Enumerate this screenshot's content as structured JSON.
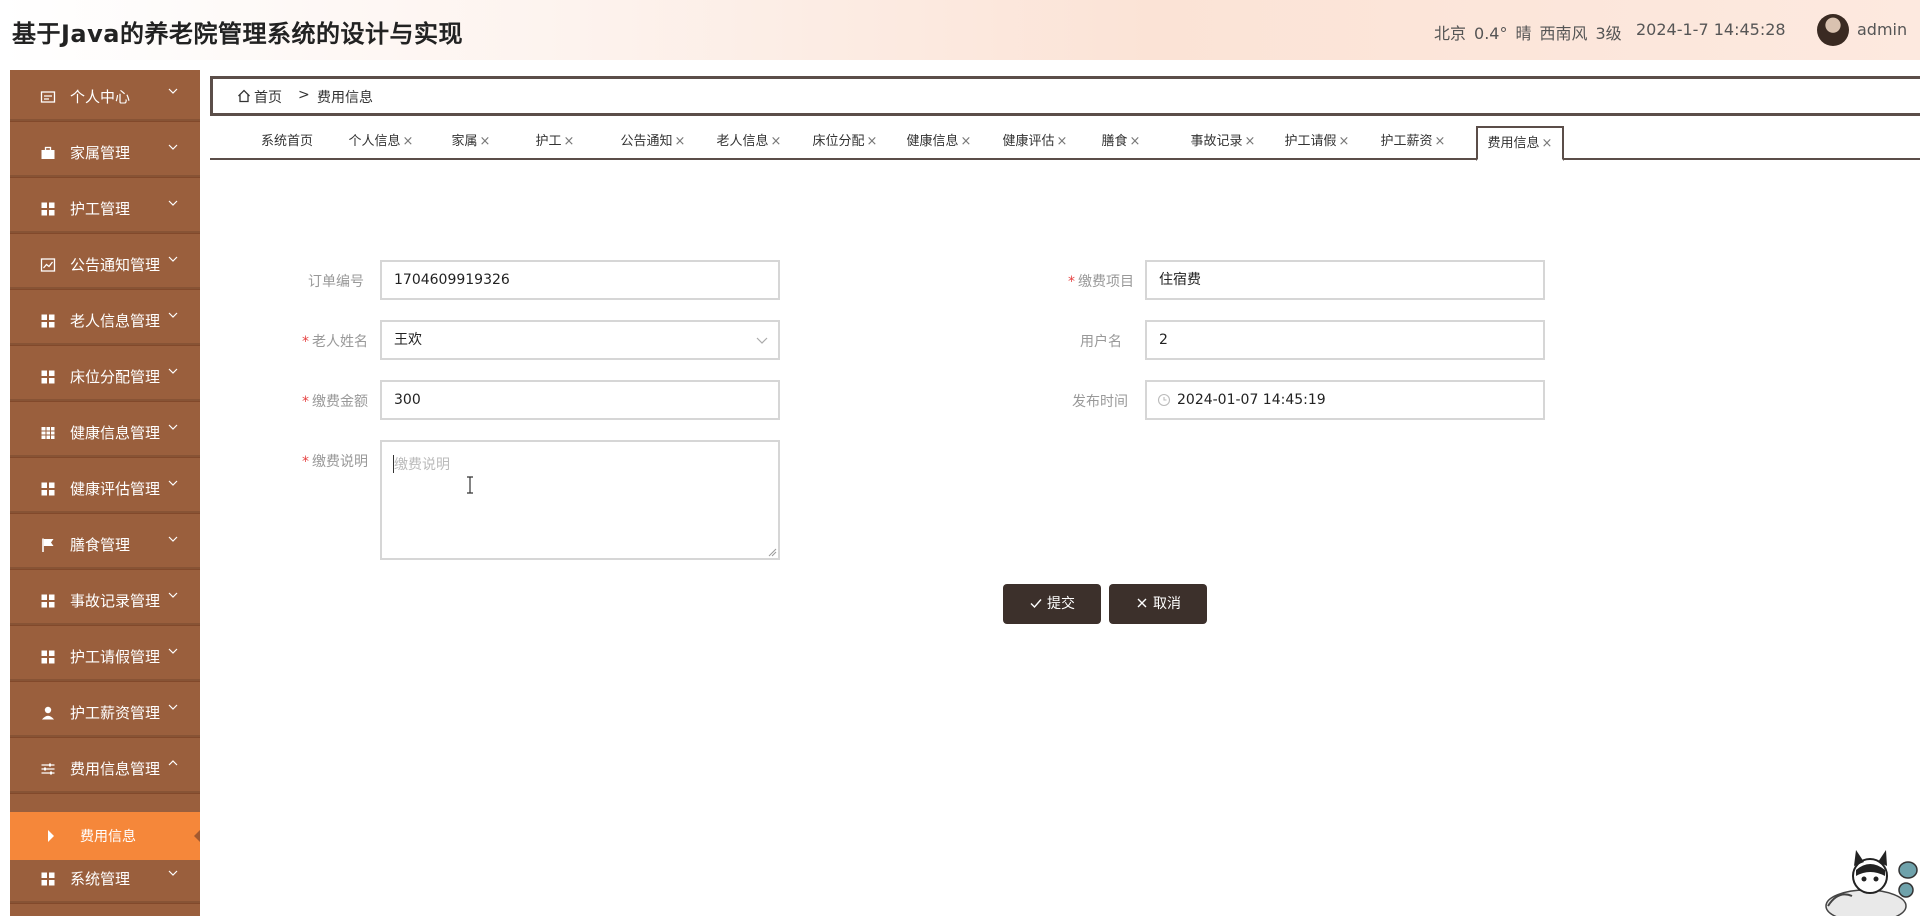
{
  "header": {
    "title": "基于Java的养老院管理系统的设计与实现",
    "weather": {
      "city": "北京",
      "temp": "0.4°",
      "condition": "晴",
      "wind": "西南风",
      "level": "3级"
    },
    "datetime": "2024-1-7 14:45:28",
    "user": "admin"
  },
  "sidebar": {
    "items": [
      {
        "label": "个人中心",
        "icon": "id-card-icon"
      },
      {
        "label": "家属管理",
        "icon": "briefcase-icon"
      },
      {
        "label": "护工管理",
        "icon": "grid-icon"
      },
      {
        "label": "公告通知管理",
        "icon": "chart-icon"
      },
      {
        "label": "老人信息管理",
        "icon": "grid-icon"
      },
      {
        "label": "床位分配管理",
        "icon": "grid-icon"
      },
      {
        "label": "健康信息管理",
        "icon": "table-icon"
      },
      {
        "label": "健康评估管理",
        "icon": "grid-icon"
      },
      {
        "label": "膳食管理",
        "icon": "flag-icon"
      },
      {
        "label": "事故记录管理",
        "icon": "grid-icon"
      },
      {
        "label": "护工请假管理",
        "icon": "grid-icon"
      },
      {
        "label": "护工薪资管理",
        "icon": "user-icon"
      },
      {
        "label": "费用信息管理",
        "icon": "sliders-icon"
      },
      {
        "label": "系统管理",
        "icon": "grid-icon"
      }
    ],
    "sub_item": "费用信息"
  },
  "breadcrumb": {
    "home": "首页",
    "separator": ">",
    "current": "费用信息"
  },
  "tabs": [
    "系统首页",
    "个人信息",
    "家属",
    "护工",
    "公告通知",
    "老人信息",
    "床位分配",
    "健康信息",
    "健康评估",
    "膳食",
    "事故记录",
    "护工请假",
    "护工薪资",
    "费用信息"
  ],
  "tab_close": "×",
  "form": {
    "order_no_label": "订单编号",
    "order_no": "1704609919326",
    "fee_item_label": "缴费项目",
    "fee_item": "住宿费",
    "elder_name_label": "老人姓名",
    "elder_name": "王欢",
    "username_label": "用户名",
    "username": "2",
    "amount_label": "缴费金额",
    "amount": "300",
    "publish_time_label": "发布时间",
    "publish_time": "2024-01-07 14:45:19",
    "desc_label": "缴费说明",
    "desc_placeholder": "缴费说明",
    "required_mark": "*"
  },
  "buttons": {
    "submit": "提交",
    "cancel": "取消"
  },
  "colors": {
    "sidebar": "#9a5f3d",
    "active_sub": "#f5873a",
    "button": "#3c302b",
    "border": "#5b4e49"
  }
}
